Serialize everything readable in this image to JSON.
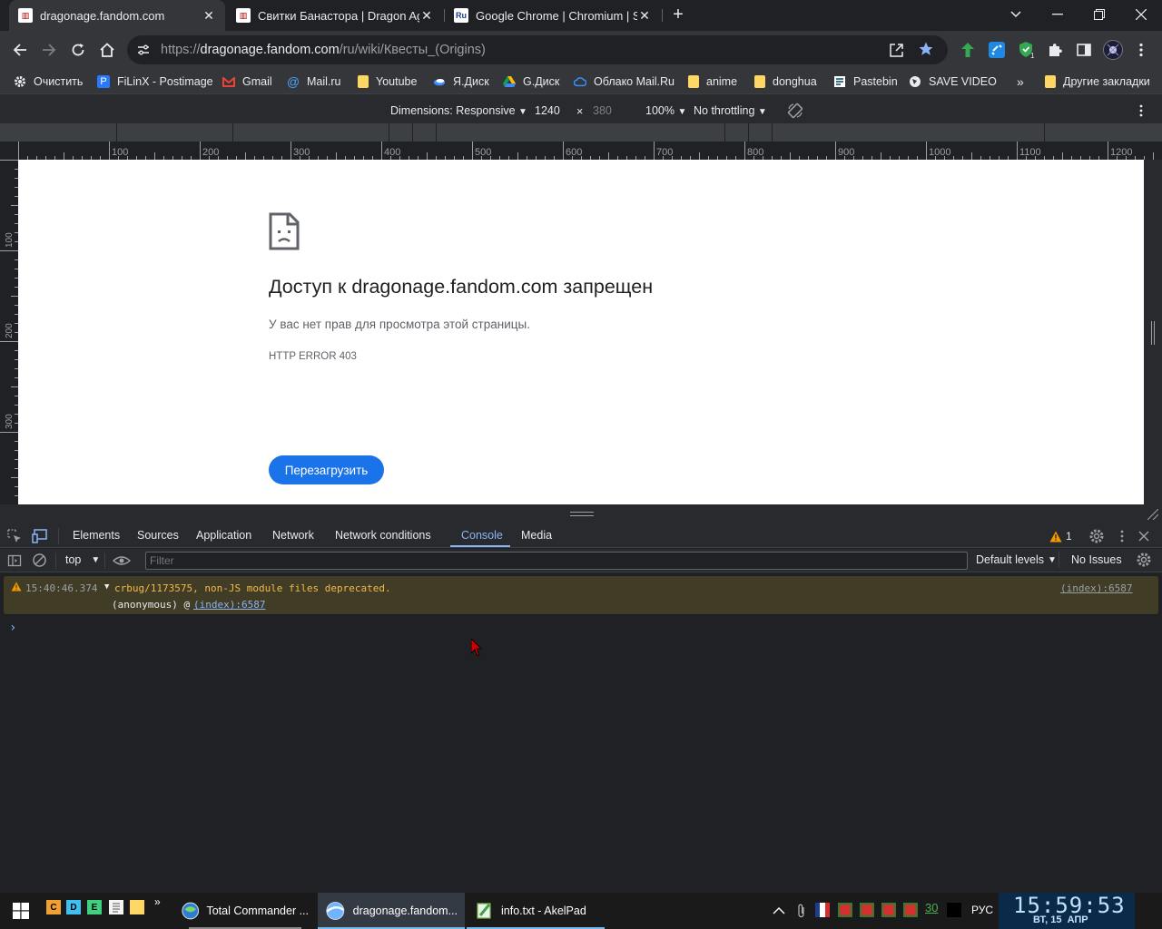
{
  "tabs": [
    {
      "title": "dragonage.fandom.com",
      "favicon": "fandom-icon",
      "active": true
    },
    {
      "title": "Свитки Банастора | Dragon Age",
      "favicon": "fandom-icon",
      "active": false
    },
    {
      "title": "Google Chrome | Chromium | SR",
      "favicon": "ru-icon",
      "favicon_text": "Ru",
      "active": false
    }
  ],
  "address": {
    "scheme": "https://",
    "host": "dragonage.fandom.com",
    "path": "/ru/wiki/Квесты_(Origins)"
  },
  "bookmarks": [
    {
      "label": "Очистить",
      "icon": "gear-icon"
    },
    {
      "label": "FiLinX - Postimage",
      "icon": "postimage-icon"
    },
    {
      "label": "Gmail",
      "icon": "gmail-icon"
    },
    {
      "label": "Mail.ru",
      "icon": "at-icon"
    },
    {
      "label": "Youtube",
      "icon": "folder-icon"
    },
    {
      "label": "Я.Диск",
      "icon": "yadisk-icon"
    },
    {
      "label": "G.Диск",
      "icon": "gdrive-icon"
    },
    {
      "label": "Облако Mail.Ru",
      "icon": "cloud-icon"
    },
    {
      "label": "anime",
      "icon": "folder-icon"
    },
    {
      "label": "donghua",
      "icon": "folder-icon"
    },
    {
      "label": "Pastebin",
      "icon": "pastebin-icon"
    },
    {
      "label": "SAVE VIDEO",
      "icon": "globe-icon"
    }
  ],
  "bookmarks_more": "»",
  "other_bookmarks": "Другие закладки",
  "device": {
    "dimensions": "Dimensions: Responsive",
    "width": "1240",
    "times": "×",
    "height": "380",
    "zoom": "100%",
    "throttling": "No throttling"
  },
  "ruler": {
    "h_labels": [
      "100",
      "200",
      "300",
      "400",
      "500",
      "600",
      "700",
      "800",
      "900",
      "1000",
      "1100",
      "1200"
    ],
    "v_labels": [
      "100",
      "200",
      "300"
    ]
  },
  "page": {
    "title": "Доступ к dragonage.fandom.com запрещен",
    "description": "У вас нет прав для просмотра этой страницы.",
    "error_code": "HTTP ERROR 403",
    "reload_label": "Перезагрузить"
  },
  "devtools": {
    "tabs": [
      "Elements",
      "Sources",
      "Application",
      "Network",
      "Network conditions",
      "Console",
      "Media"
    ],
    "active_tab": "Console",
    "issues_count": "1",
    "context": "top",
    "filter_placeholder": "Filter",
    "levels": "Default levels",
    "issues": "No Issues",
    "warning": {
      "time": "15:40:46.374",
      "message": "crbug/1173575, non-JS module files deprecated.",
      "stack": "(anonymous) @ ",
      "link": "(index):6587",
      "source": "(index):6587"
    },
    "prompt": "›"
  },
  "taskbar": {
    "quicklaunch": [
      {
        "label": "C",
        "color": "#f0a030"
      },
      {
        "label": "D",
        "color": "#40c0f0"
      },
      {
        "label": "E",
        "color": "#40d080"
      }
    ],
    "more": "»",
    "apps": [
      {
        "label": "Total Commander ...",
        "icon": "total-commander-icon"
      },
      {
        "label": "dragonage.fandom...",
        "icon": "browser-icon",
        "active": true
      },
      {
        "label": "info.txt - AkelPad",
        "icon": "akelpad-icon"
      }
    ],
    "tray_number": "30",
    "language": "РУС",
    "time": "15:59:53",
    "date": "ВТ, 15  АПР"
  },
  "colors": {
    "accent": "#8ab4f8",
    "button": "#1a73e8",
    "warning_bg": "#413c26",
    "warning_text": "#f2b94d"
  }
}
